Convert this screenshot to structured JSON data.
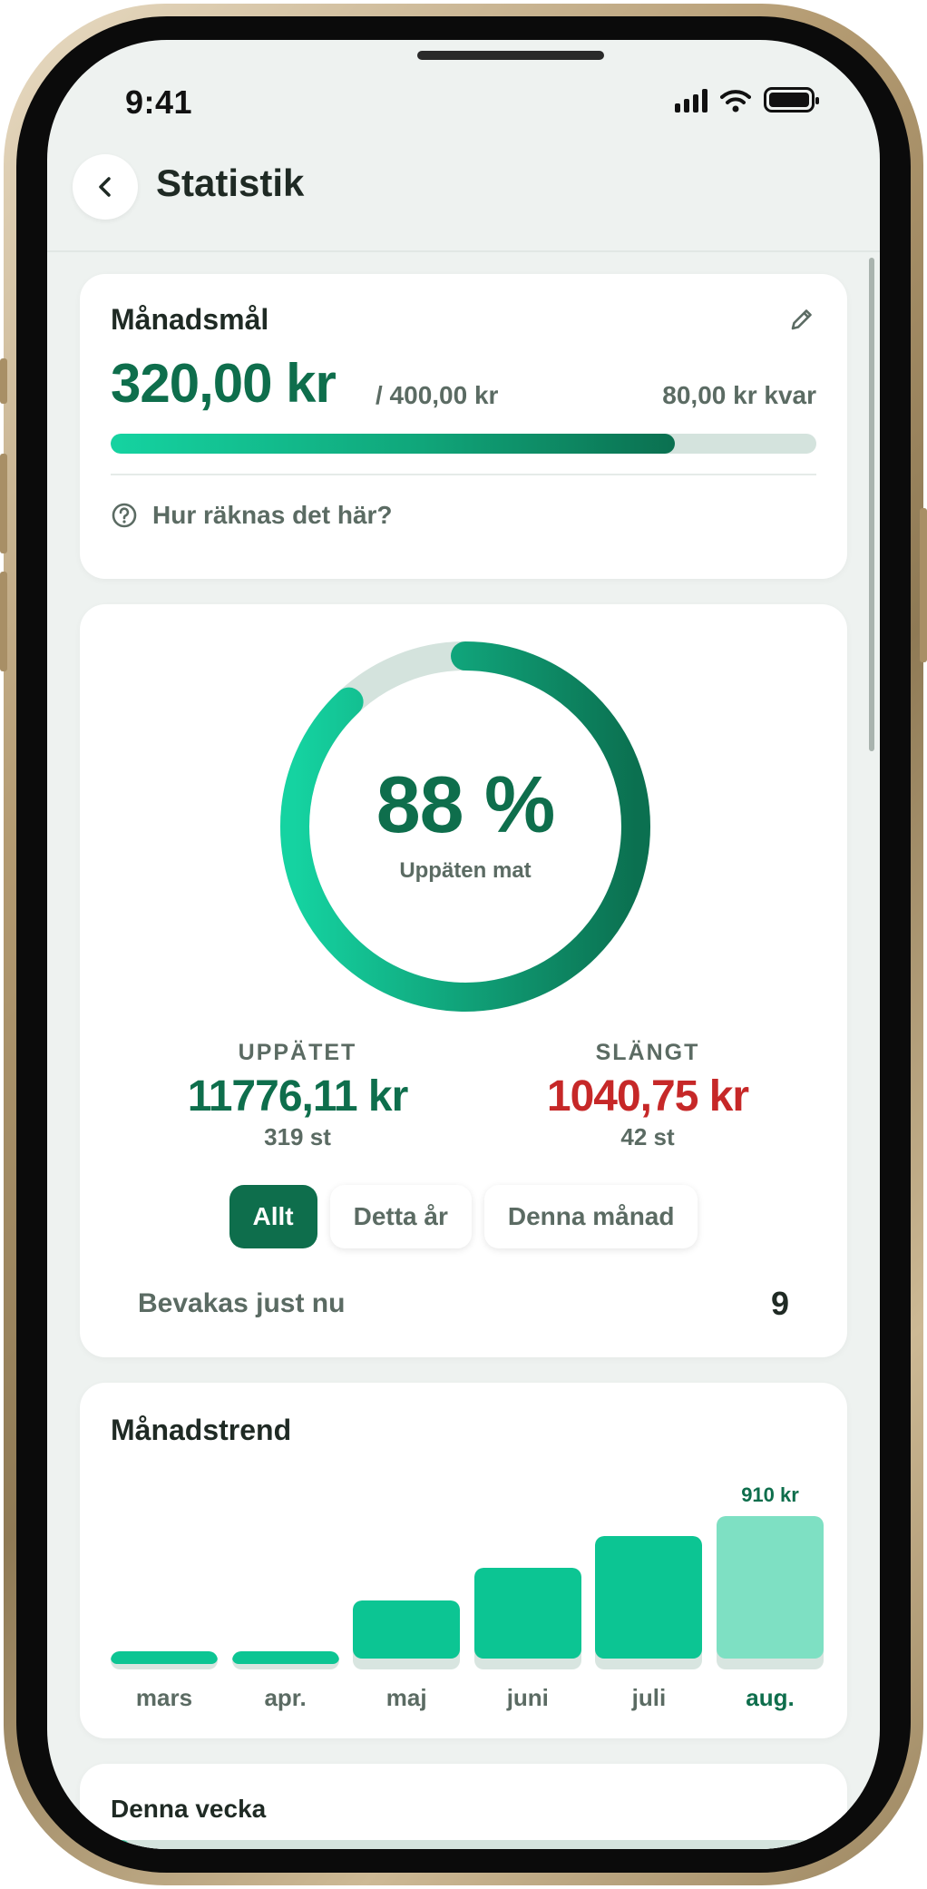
{
  "status_bar": {
    "time": "9:41"
  },
  "header": {
    "title": "Statistik"
  },
  "goal": {
    "title": "Månadsmål",
    "amount": "320,00 kr",
    "of_total": "/ 400,00 kr",
    "remaining": "80,00 kr kvar",
    "progress": 0.8,
    "help_text": "Hur räknas det här?"
  },
  "stats": {
    "percent_text": "88 %",
    "percent_label": "Uppäten mat",
    "percent": 0.88,
    "eaten": {
      "label": "UPPÄTET",
      "value": "11776,11 kr",
      "count": "319 st"
    },
    "thrown": {
      "label": "SLÄNGT",
      "value": "1040,75 kr",
      "count": "42 st"
    },
    "filters": [
      "Allt",
      "Detta år",
      "Denna månad"
    ],
    "active_filter": "Allt",
    "watching_label": "Bevakas just nu",
    "watching_value": "9"
  },
  "trend": {
    "title": "Månadstrend",
    "current_month_value": "910 kr"
  },
  "chart_data": {
    "type": "bar",
    "title": "Månadstrend",
    "categories": [
      "mars",
      "apr.",
      "maj",
      "juni",
      "juli",
      "aug."
    ],
    "values": [
      40,
      60,
      410,
      600,
      790,
      910
    ],
    "series": [
      {
        "values": [
          40,
          60,
          410,
          600,
          790,
          910
        ]
      }
    ],
    "highlighted_category": "aug.",
    "data_labels": {
      "aug.": "910 kr"
    },
    "ylim": [
      0,
      1000
    ],
    "grid": false,
    "colors": {
      "bar": "#0cc593",
      "current": "#7ee0c3",
      "track": "#d8e5e0"
    }
  },
  "week": {
    "title": "Denna vecka",
    "progress": 0.03
  },
  "colors": {
    "primary": "#0e6e4c",
    "accent": "#15d3a1",
    "danger": "#c62828",
    "muted_text": "#5b6b63",
    "background": "#eef2f0"
  },
  "icons": {
    "back": "chevron-left-icon",
    "edit": "pencil-icon",
    "help": "question-circle-icon",
    "signal": "cellular-signal-icon",
    "wifi": "wifi-icon",
    "battery": "battery-icon"
  }
}
